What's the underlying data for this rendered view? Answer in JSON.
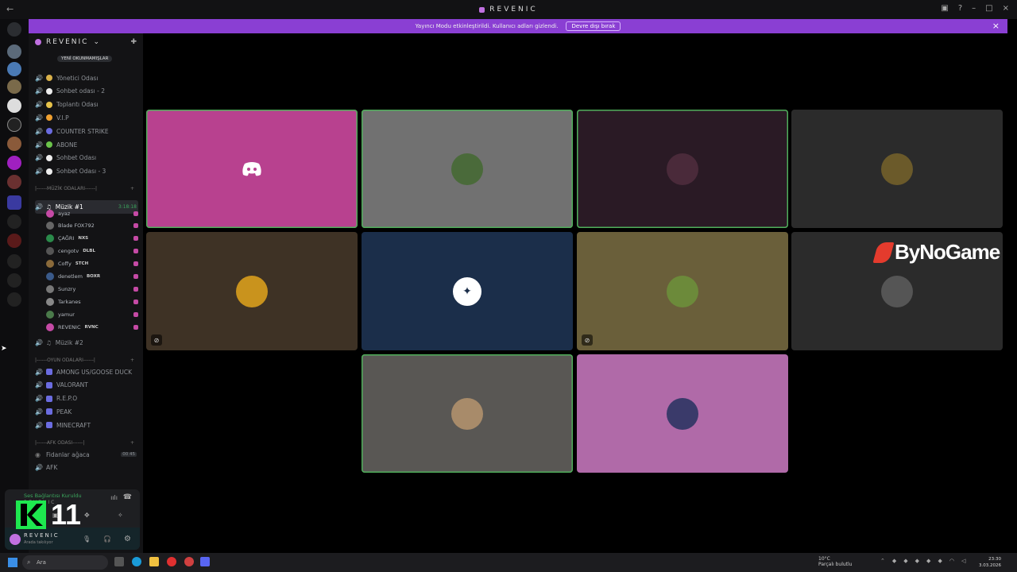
{
  "window": {
    "title": "REVENIC",
    "back_icon": "arrow-left"
  },
  "banner": {
    "text": "Yayıncı Modu etkinleştirildi. Kullanıcı adları gizlendi.",
    "button": "Devre dışı bırak"
  },
  "server": {
    "name": "REVENIC"
  },
  "tooltip": "YENİ OKUNMAMIŞLAR",
  "channels_top": [
    {
      "name": "Yönetici Odası",
      "emoji_color": "#d9b14a"
    },
    {
      "name": "Sohbet odası - 2",
      "emoji_color": "#eee"
    },
    {
      "name": "Toplantı Odası",
      "emoji_color": "#e6c24a"
    },
    {
      "name": "V.I.P",
      "emoji_color": "#f0a030"
    },
    {
      "name": "COUNTER STRIKE",
      "emoji_color": "#6b6ce0"
    },
    {
      "name": "ABONE",
      "emoji_color": "#6ac34a"
    },
    {
      "name": "Sohbet Odası",
      "emoji_color": "#eee"
    },
    {
      "name": "Sohbet Odası - 3",
      "emoji_color": "#eee"
    }
  ],
  "category_music": "|------MÜZİK ODALARI------|",
  "active_channel": {
    "name": "Müzik #1",
    "timer": "3:18:18"
  },
  "voice_users": [
    {
      "name": "ayaz",
      "tag": ""
    },
    {
      "name": "Blade FOX792",
      "tag": ""
    },
    {
      "name": "ÇAĞRI",
      "tag": "NXS"
    },
    {
      "name": "cengotv",
      "tag": "DLBL"
    },
    {
      "name": "Coffy",
      "tag": "STCH"
    },
    {
      "name": "denetlem",
      "tag": "BOXR"
    },
    {
      "name": "Sunzry",
      "tag": ""
    },
    {
      "name": "Tarkanes",
      "tag": ""
    },
    {
      "name": "yamur",
      "tag": ""
    },
    {
      "name": "REVENIC",
      "tag": "RVNC"
    }
  ],
  "channel_music2": "Müzik #2",
  "category_games": "|------OYUN ODALARI------|",
  "game_channels": [
    "AMONG US/GOOSE DUCK",
    "VALORANT",
    "R.E.P.O",
    "PEAK",
    "MINECRAFT"
  ],
  "category_afk": "|------AFK ODASI------|",
  "afk_channels": [
    {
      "name": "Fidanlar ağaca",
      "counts": "00  45"
    },
    {
      "name": "AFK",
      "counts": ""
    }
  ],
  "user_panel": {
    "connection": "Ses Bağlantısı Kuruldu",
    "server": "REVENIC",
    "username": "REVENIC",
    "status": "Arada takılıyor"
  },
  "overlay_logo": {
    "letter": "K",
    "number": "11"
  },
  "stage": {
    "bynogame": "ByNoGame",
    "tiles": [
      {
        "bg": "#b8418f",
        "speaking": true,
        "avatar": "discord-icon",
        "av_bg": "transparent",
        "muted": false
      },
      {
        "bg": "#717171",
        "speaking": true,
        "avatar": "user-avatar",
        "av_bg": "#4a6a3a",
        "muted": false
      },
      {
        "bg": "#2a1a25",
        "speaking": true,
        "avatar": "user-avatar",
        "av_bg": "#4a2a3a",
        "muted": false
      },
      {
        "bg": "#2b2b2b",
        "speaking": false,
        "avatar": "user-avatar",
        "av_bg": "#6b5a2a",
        "muted": false
      },
      {
        "bg": "#3e3225",
        "speaking": false,
        "avatar": "user-avatar",
        "av_bg": "#c9931d",
        "muted": true
      },
      {
        "bg": "#1b2e4a",
        "speaking": false,
        "avatar": "subaru-logo",
        "av_bg": "#ffffff",
        "muted": false
      },
      {
        "bg": "#6a5f3a",
        "speaking": false,
        "avatar": "user-avatar",
        "av_bg": "#6c8a3a",
        "muted": true
      },
      {
        "bg": "#2b2b2b",
        "speaking": false,
        "avatar": "user-avatar",
        "av_bg": "#555",
        "muted": false
      },
      {
        "bg": "#595754",
        "speaking": true,
        "avatar": "user-avatar",
        "av_bg": "#a88b6a",
        "muted": false
      },
      {
        "bg": "#b06aa8",
        "speaking": false,
        "avatar": "user-avatar",
        "av_bg": "#3a3a6a",
        "muted": false
      }
    ]
  },
  "taskbar": {
    "search_placeholder": "Ara",
    "weather_temp": "10°C",
    "weather_desc": "Parçalı bulutlu",
    "time": "23:30",
    "date": "3.03.2026"
  }
}
